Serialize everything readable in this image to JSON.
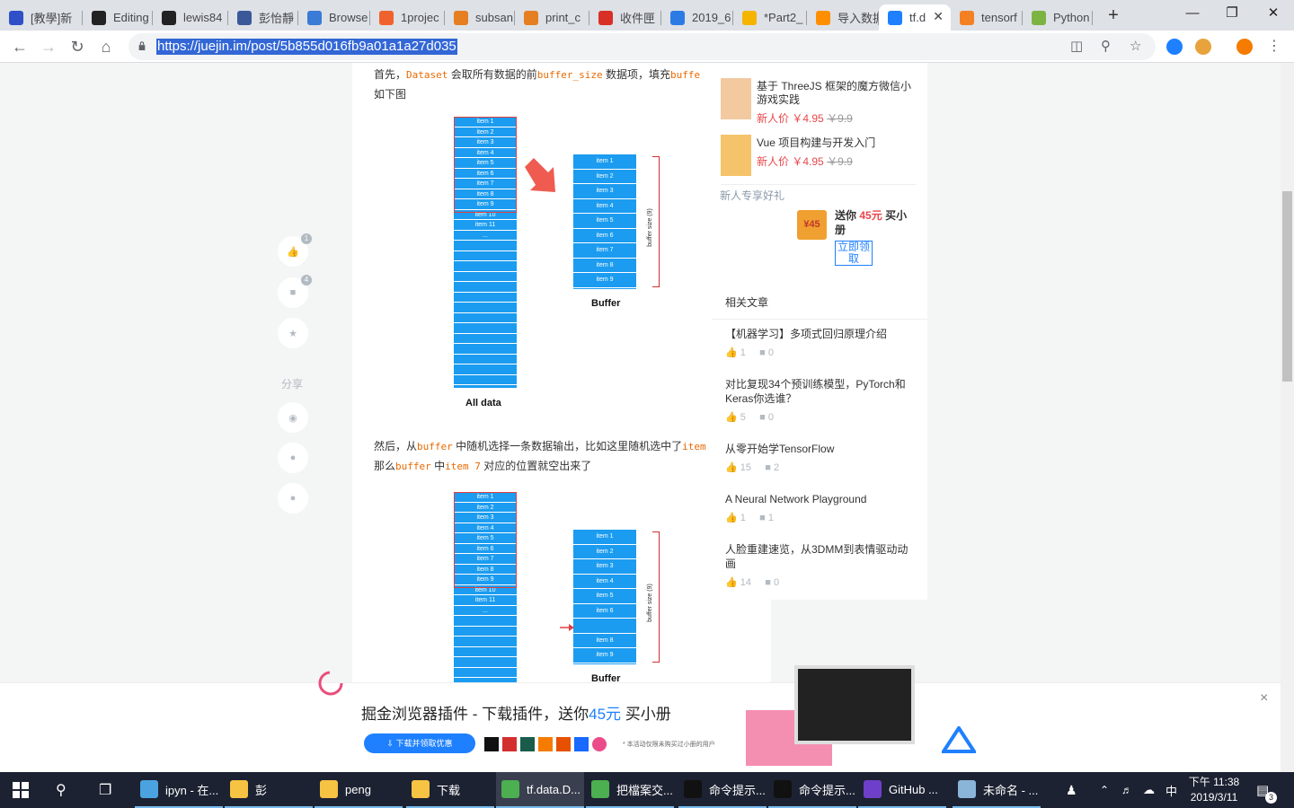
{
  "browser": {
    "tabs": [
      {
        "label": "[教學]新",
        "icon": "blue-book-icon",
        "color": "#3050c8"
      },
      {
        "label": "Editing",
        "icon": "github-icon",
        "color": "#222222"
      },
      {
        "label": "lewis84",
        "icon": "github-icon",
        "color": "#222222"
      },
      {
        "label": "彭怡靜",
        "icon": "facebook-icon",
        "color": "#3b5998"
      },
      {
        "label": "Browse",
        "icon": "browse-icon",
        "color": "#3a7bd5"
      },
      {
        "label": "1projec",
        "icon": "orange-ring-icon",
        "color": "#f0622d"
      },
      {
        "label": "subsan",
        "icon": "orange-doc-icon",
        "color": "#e67e22"
      },
      {
        "label": "print_c",
        "icon": "orange-doc-icon",
        "color": "#e67e22"
      },
      {
        "label": "收件匣",
        "icon": "gmail-icon",
        "color": "#d93025"
      },
      {
        "label": "2019_6",
        "icon": "share-icon",
        "color": "#2c7be5"
      },
      {
        "label": "*Part2_",
        "icon": "co-icon",
        "color": "#f4b400"
      },
      {
        "label": "导入数据",
        "icon": "orange-t-icon",
        "color": "#ff8f00"
      },
      {
        "label": "tf.d",
        "icon": "juejin-icon",
        "color": "#1e80ff"
      },
      {
        "label": "tensorf",
        "icon": "stack-icon",
        "color": "#f48024"
      },
      {
        "label": "Python",
        "icon": "python-icon",
        "color": "#7cb342"
      }
    ],
    "url": "https://juejin.im/post/5b855d016fb9a01a1a27d035"
  },
  "article": {
    "para1_a": "首先，",
    "para1_code1": "Dataset",
    "para1_b": "会取所有数据的前",
    "para1_code2": "buffer_size",
    "para1_c": "数据项，填充",
    "para1_code3": "buffe",
    "para1_line2": "如下图",
    "para2_a": "然后，从",
    "para2_code1": "buffer",
    "para2_b": "中随机选择一条数据输出，比如这里随机选中了",
    "para2_code2": "item",
    "para2_line2_a": "那么",
    "para2_line2_code1": "buffer",
    "para2_line2_b": "中",
    "para2_line2_code2": "item 7",
    "para2_line2_c": "对应的位置就空出来了",
    "diagram1": {
      "items": [
        "item 1",
        "item 2",
        "item 3",
        "item 4",
        "item 5",
        "item 6",
        "item 7",
        "item 8",
        "item 9",
        "item 10",
        "item 11",
        "..."
      ],
      "buffer_items": [
        "item 1",
        "item 2",
        "item 3",
        "item 4",
        "item 5",
        "item 6",
        "item 7",
        "item 8",
        "item 9"
      ],
      "all_data_label": "All data",
      "buffer_label": "Buffer",
      "buffer_size_label": "buffer size (9)"
    },
    "diagram2": {
      "items": [
        "item 1",
        "item 2",
        "item 3",
        "item 4",
        "item 5",
        "item 6",
        "item 7",
        "item 8",
        "item 9",
        "item 10",
        "item 11",
        "..."
      ],
      "buffer_items": [
        "item 1",
        "item 2",
        "item 3",
        "item 4",
        "item 5",
        "item 6",
        "",
        "item 8",
        "item 9"
      ],
      "buffer_label": "Buffer",
      "buffer_size_label": "buffer size (9)"
    }
  },
  "actions": {
    "like_count": "1",
    "comment_count": "4",
    "share_label": "分享"
  },
  "sidebar": {
    "books": [
      {
        "title": "基于 ThreeJS 框架的魔方微信小游戏实践",
        "price_label": "新人价",
        "price": "￥4.95",
        "old_price": "￥9.9"
      },
      {
        "title": "Vue 项目构建与开发入门",
        "price_label": "新人价",
        "price": "￥4.95",
        "old_price": "￥9.9"
      }
    ],
    "promo_title": "新人专享好礼",
    "promo_text_a": "送你",
    "promo_amount": "45元",
    "promo_text_b": "买小册",
    "promo_badge": "¥45",
    "promo_button": "立即领取",
    "related_title": "相关文章",
    "related": [
      {
        "title": "【机器学习】多项式回归原理介绍",
        "likes": "1",
        "comments": "0"
      },
      {
        "title": "对比复现34个预训练模型，PyTorch和Keras你选谁？",
        "likes": "5",
        "comments": "0"
      },
      {
        "title": "从零开始学TensorFlow",
        "likes": "15",
        "comments": "2"
      },
      {
        "title": "A Neural Network Playground",
        "likes": "1",
        "comments": "1"
      },
      {
        "title": "人脸重建速览，从3DMM到表情驱动动画",
        "likes": "14",
        "comments": "0"
      }
    ]
  },
  "banner": {
    "title_a": "掘金浏览器插件 - 下载插件，送你",
    "title_amount": "45元",
    "title_b": "买小册",
    "download_button": "下载并领取优惠",
    "note": "* 本活动仅限未购买过小册的用户",
    "close": "×"
  },
  "taskbar": {
    "items": [
      {
        "label": "ipyn - 在...",
        "color": "#4aa3df"
      },
      {
        "label": "彭",
        "color": "#f6c343"
      },
      {
        "label": "peng",
        "color": "#f6c343"
      },
      {
        "label": "下载",
        "color": "#f6c343"
      },
      {
        "label": "tf.data.D...",
        "color": "#4caf50"
      },
      {
        "label": "把檔案交...",
        "color": "#4caf50"
      },
      {
        "label": "命令提示...",
        "color": "#111111"
      },
      {
        "label": "命令提示...",
        "color": "#111111"
      },
      {
        "label": "GitHub ...",
        "color": "#6e40c9"
      },
      {
        "label": "未命名 - ...",
        "color": "#8ab4d8"
      }
    ],
    "ime": "中",
    "time": "下午 11:38",
    "date": "2019/3/11",
    "notif_count": "3"
  }
}
